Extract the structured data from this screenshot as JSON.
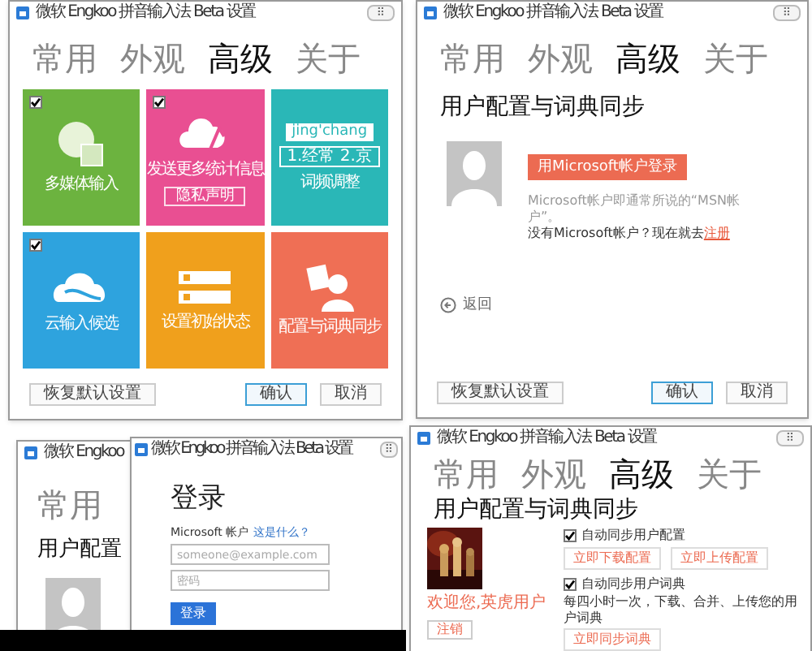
{
  "tiles_window": {
    "title": "微软 Engkoo 拼音输入法 Beta 设置",
    "close": "⠿",
    "tabs": [
      {
        "label": "常用",
        "selected": false
      },
      {
        "label": "外观",
        "selected": false
      },
      {
        "label": "高级",
        "selected": true
      },
      {
        "label": "关于",
        "selected": false
      }
    ],
    "tiles": [
      {
        "kind": "media",
        "label": "多媒体输入",
        "checked": true,
        "color": "#6cb33f"
      },
      {
        "kind": "stats",
        "label": "发送更多统计信息",
        "checked": true,
        "color": "#e94f92",
        "link": "隐私声明"
      },
      {
        "kind": "freq",
        "label": "词频调整",
        "color": "#2ab7b7",
        "pinyin": "jing'chang",
        "choices": "1.经常 2.京"
      },
      {
        "kind": "cloud",
        "label": "云输入候选",
        "checked": true,
        "color": "#2ea3de"
      },
      {
        "kind": "init",
        "label": "设置初始状态",
        "color": "#f0a01c"
      },
      {
        "kind": "sync",
        "label": "配置与词典同步",
        "color": "#ef6f55"
      }
    ],
    "reset": "恢复默认设置",
    "ok": "确认",
    "cancel": "取消"
  },
  "login_prompt_window": {
    "title": "微软 Engkoo 拼音输入法 Beta 设置",
    "close": "⠿",
    "tabs": [
      {
        "label": "常用",
        "selected": false
      },
      {
        "label": "外观",
        "selected": false
      },
      {
        "label": "高级",
        "selected": true
      },
      {
        "label": "关于",
        "selected": false
      }
    ],
    "heading": "用户配置与词典同步",
    "signin": "用Microsoft帐户登录",
    "note": "Microsoft帐户即通常所说的“MSN帐户”。",
    "no_account": "没有Microsoft帐户？现在就去",
    "register": "注册",
    "back": "返回",
    "reset": "恢复默认设置",
    "ok": "确认",
    "cancel": "取消"
  },
  "login_dialog": {
    "back_window": {
      "title": "微软 Engkoo",
      "tab": "常用",
      "heading": "用户配置"
    },
    "title": "微软 Engkoo 拼音输入法 Beta 设置",
    "close": "⠿",
    "heading": "登录",
    "account_label": "Microsoft 帐户",
    "what_is": "这是什么？",
    "email_placeholder": "someone@example.com",
    "password_placeholder": "密码",
    "submit": "登录"
  },
  "sync_window": {
    "title": "微软 Engkoo 拼音输入法 Beta 设置",
    "close": "⠿",
    "tabs": [
      {
        "label": "常用",
        "selected": false
      },
      {
        "label": "外观",
        "selected": false
      },
      {
        "label": "高级",
        "selected": true
      },
      {
        "label": "关于",
        "selected": false
      }
    ],
    "heading": "用户配置与词典同步",
    "welcome": "欢迎您,英虎用户",
    "logout": "注销",
    "auto_config": {
      "label": "自动同步用户配置",
      "checked": true
    },
    "download": "立即下载配置",
    "upload": "立即上传配置",
    "auto_dict": {
      "label": "自动同步用户词典",
      "checked": true
    },
    "dict_note": "每四小时一次，下载、合并、上传您的用户词典",
    "sync_now": "立即同步词典"
  }
}
